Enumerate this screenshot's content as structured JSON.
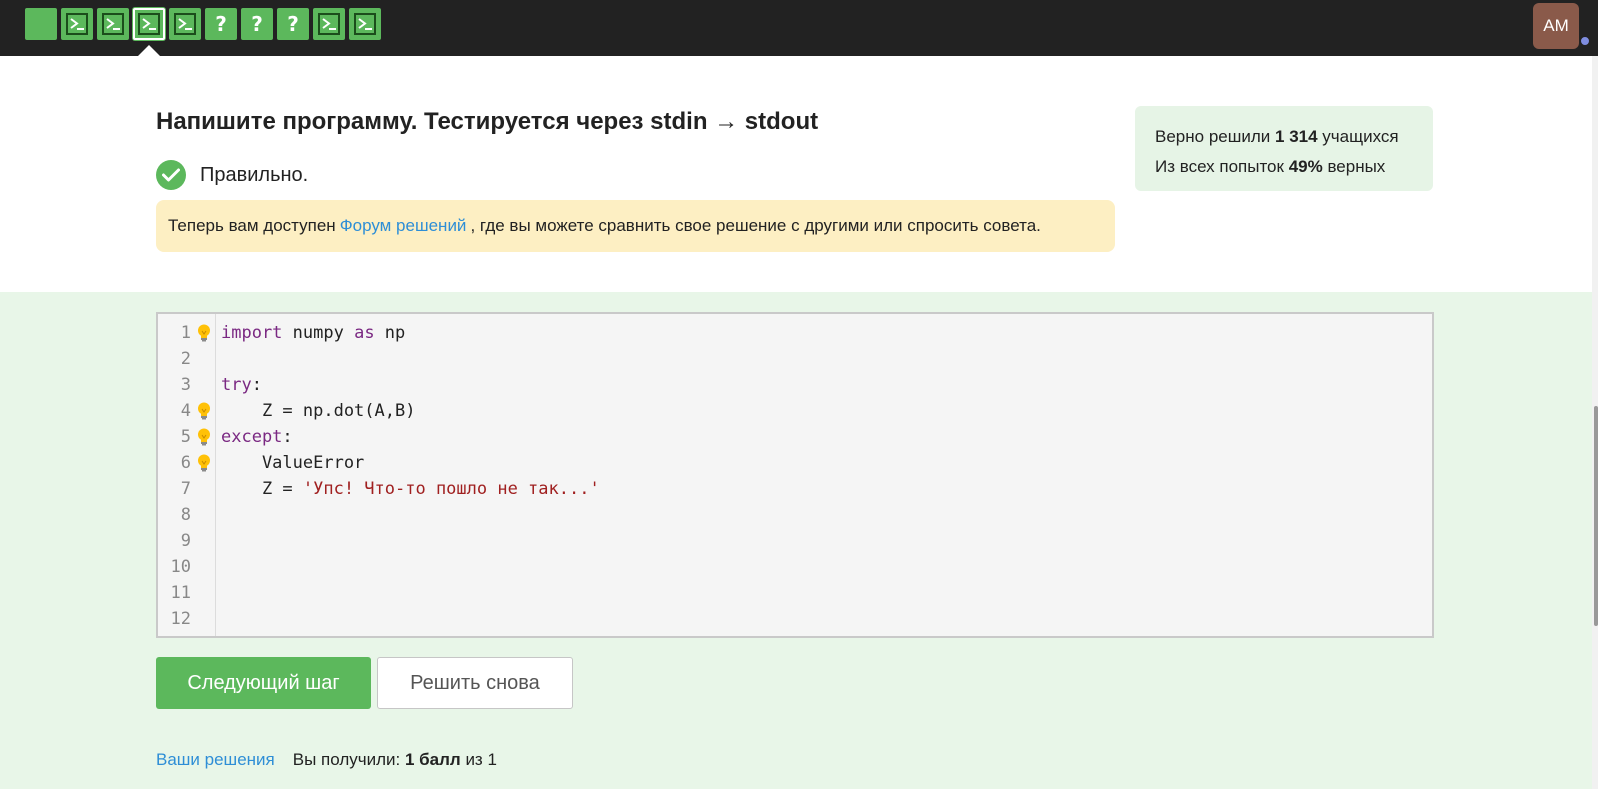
{
  "topbar": {
    "steps": [
      {
        "type": "empty",
        "state": "passed"
      },
      {
        "type": "terminal",
        "state": "passed"
      },
      {
        "type": "terminal",
        "state": "passed"
      },
      {
        "type": "terminal",
        "state": "current"
      },
      {
        "type": "terminal",
        "state": "passed"
      },
      {
        "type": "question",
        "label": "?",
        "state": "passed"
      },
      {
        "type": "question",
        "label": "?",
        "state": "passed"
      },
      {
        "type": "question",
        "label": "?",
        "state": "passed"
      },
      {
        "type": "terminal",
        "state": "passed"
      },
      {
        "type": "terminal",
        "state": "passed"
      }
    ],
    "avatar_initials": "AM"
  },
  "task": {
    "title": "Напишите программу. Тестируется через stdin → stdout",
    "status": "Правильно.",
    "notice": {
      "before": "Теперь вам доступен",
      "link": "Форум решений",
      "after": ", где вы можете сравнить свое решение с другими или спросить совета."
    }
  },
  "stats": {
    "line1_prefix": "Верно решили",
    "solved_count": "1 314",
    "line1_suffix": "учащихся",
    "line2_prefix": "Из всех попыток",
    "percent": "49%",
    "line2_suffix": "верных"
  },
  "editor": {
    "line_numbers": [
      "1",
      "2",
      "3",
      "4",
      "5",
      "6",
      "7",
      "8",
      "9",
      "10",
      "11",
      "12"
    ],
    "hint_lines": [
      1,
      4,
      5,
      6
    ],
    "lines": [
      [
        {
          "t": "import",
          "c": "kw"
        },
        {
          "t": " numpy ",
          "c": ""
        },
        {
          "t": "as",
          "c": "kw"
        },
        {
          "t": " np",
          "c": ""
        }
      ],
      [],
      [
        {
          "t": "try",
          "c": "kw"
        },
        {
          "t": ":",
          "c": ""
        }
      ],
      [
        {
          "t": "    Z = np.dot(A,B)",
          "c": ""
        }
      ],
      [
        {
          "t": "except",
          "c": "kw"
        },
        {
          "t": ":",
          "c": ""
        }
      ],
      [
        {
          "t": "    ValueError",
          "c": ""
        }
      ],
      [
        {
          "t": "    Z = ",
          "c": ""
        },
        {
          "t": "'Упс! Что-то пошло не так...'",
          "c": "str"
        }
      ],
      [],
      [],
      [],
      [],
      []
    ]
  },
  "buttons": {
    "next": "Следующий шаг",
    "again": "Решить снова"
  },
  "footer": {
    "solutions_link": "Ваши решения",
    "score_prefix": "Вы получили:",
    "score_value": "1 балл",
    "score_suffix": "из 1"
  },
  "colors": {
    "accent_green": "#5cb85c",
    "topbar": "#222222",
    "notice_bg": "#fdefc3",
    "stats_bg": "#e6f4e6",
    "area_bg": "#e8f6e8",
    "link": "#2e8ed6"
  }
}
